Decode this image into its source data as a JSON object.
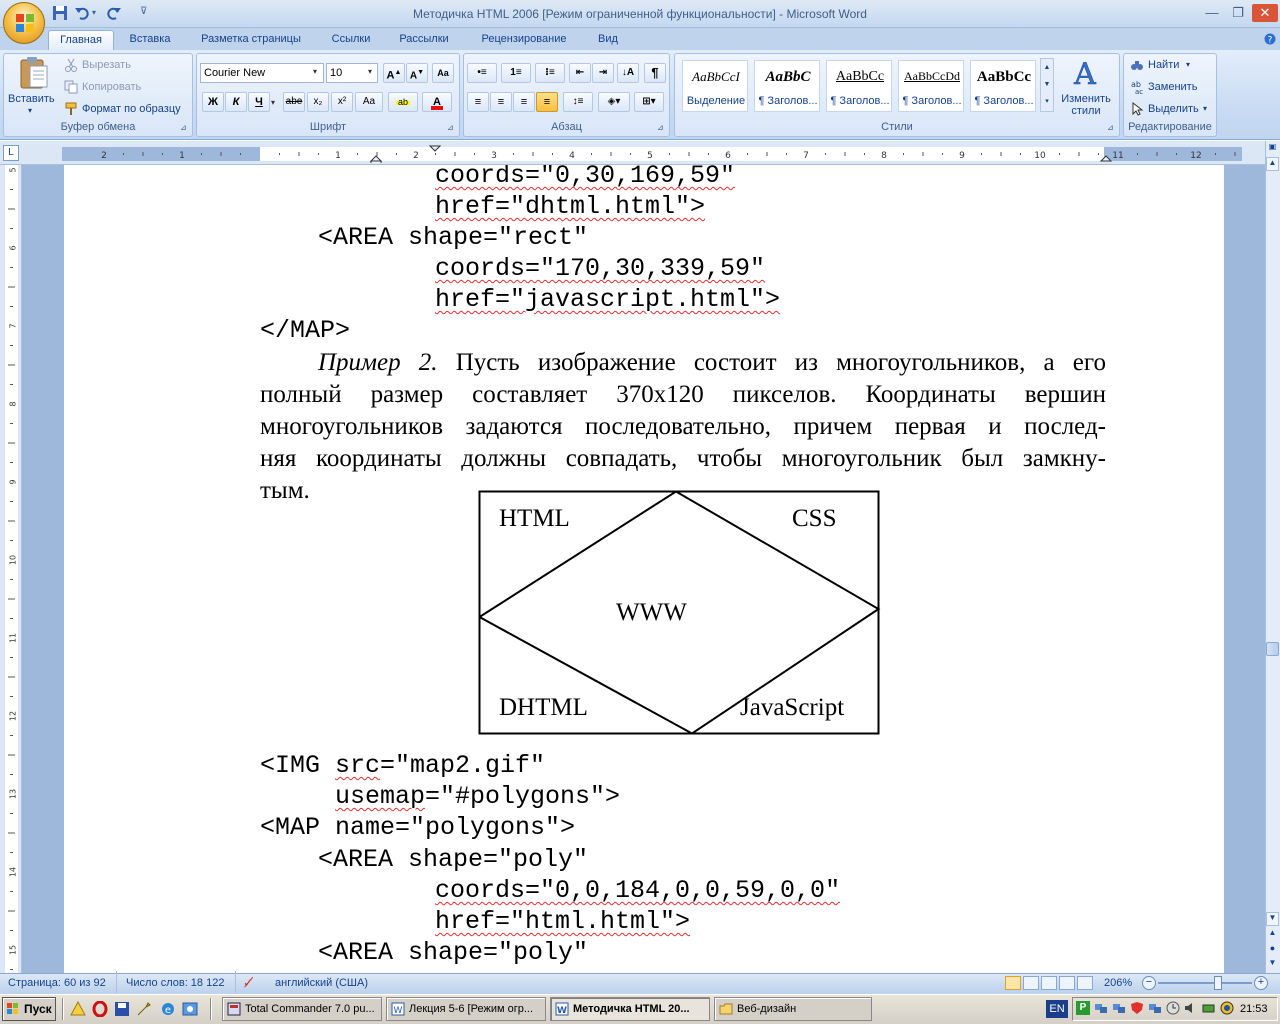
{
  "window": {
    "title": "Методичка HTML 2006 [Режим ограниченной функциональности] - Microsoft Word"
  },
  "tabs": [
    "Главная",
    "Вставка",
    "Разметка страницы",
    "Ссылки",
    "Рассылки",
    "Рецензирование",
    "Вид"
  ],
  "ribbon": {
    "clipboard": {
      "paste": "Вставить",
      "cut": "Вырезать",
      "copy": "Копировать",
      "format_painter": "Формат по образцу",
      "label": "Буфер обмена"
    },
    "font": {
      "name": "Courier New",
      "size": "10",
      "label": "Шрифт",
      "bold": "Ж",
      "italic": "К",
      "underline": "Ч",
      "strike": "abe",
      "sub": "x₂",
      "sup": "x²",
      "case": "Aa"
    },
    "paragraph": {
      "label": "Абзац"
    },
    "styles": {
      "label": "Стили",
      "items": [
        {
          "preview": "AaBbCcI",
          "name": "Выделение"
        },
        {
          "preview": "AaBbC",
          "name": "¶ Заголов..."
        },
        {
          "preview": "AaBbCc",
          "name": "¶ Заголов..."
        },
        {
          "preview": "AaBbCcDd",
          "name": "¶ Заголов..."
        },
        {
          "preview": "AaBbCc",
          "name": "¶ Заголов..."
        }
      ],
      "change": "Изменить стили"
    },
    "editing": {
      "find": "Найти",
      "replace": "Заменить",
      "select": "Выделить",
      "label": "Редактирование"
    }
  },
  "ruler": {
    "h_labels": [
      "2",
      "1",
      "1",
      "2",
      "3",
      "4",
      "5",
      "6",
      "7",
      "8",
      "9",
      "10",
      "11",
      "12"
    ],
    "v_labels": [
      "5",
      "6",
      "7",
      "8",
      "9",
      "10",
      "11",
      "12",
      "13",
      "14",
      "15"
    ]
  },
  "document": {
    "code1": [
      "coords=\"0,30,169,59\"",
      "href=\"dhtml.html\">",
      "<AREA shape=\"rect\"",
      "coords=\"170,30,339,59\"",
      "href=\"javascript.html\">",
      "</MAP>"
    ],
    "example_label": "Пример 2.",
    "para_lines": [
      "Пусть изображение состоит из многоугольников, а его",
      "полный размер составляет 370x120 пикселов. Координаты вершин",
      "многоугольников задаются последовательно, причем первая и послед-",
      "няя координаты должны совпадать, чтобы многоугольник был замкну-",
      "тым."
    ],
    "figure": {
      "labels": [
        "HTML",
        "CSS",
        "WWW",
        "DHTML",
        "JavaScript"
      ]
    },
    "code2": [
      "<IMG src=\"map2.gif\"",
      "usemap=\"#polygons\">",
      "<MAP name=\"polygons\">",
      "<AREA shape=\"poly\"",
      "coords=\"0,0,184,0,0,59,0,0\"",
      "href=\"html.html\">",
      "<AREA shape=\"poly\""
    ]
  },
  "status": {
    "page": "Страница: 60 из 92",
    "words": "Число слов: 18 122",
    "lang": "английский (США)",
    "zoom": "206%"
  },
  "taskbar": {
    "start": "Пуск",
    "tasks": [
      "Total Commander 7.0 pu...",
      "Лекция 5-6 [Режим огр...",
      "Методичка HTML 20...",
      "Веб-дизайн"
    ],
    "lang": "EN",
    "clock": "21:53"
  }
}
